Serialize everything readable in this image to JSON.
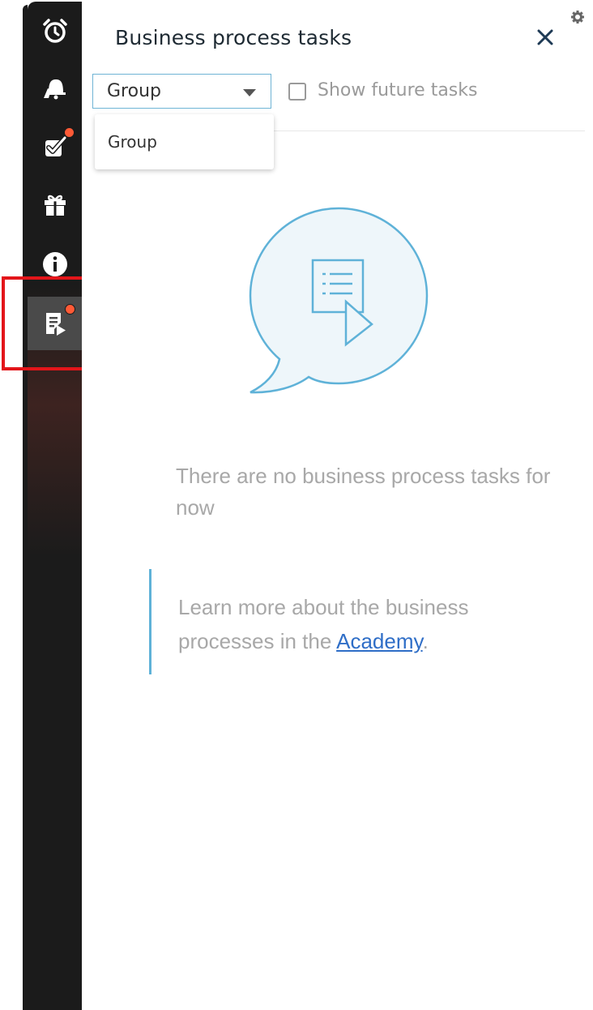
{
  "panel": {
    "title": "Business process tasks",
    "filter": {
      "selected": "Group",
      "options": [
        "Group"
      ]
    },
    "show_future_label": "Show future tasks",
    "show_future_checked": false,
    "empty_message": "There are no business process tasks for now",
    "info": {
      "before": "Learn more about the business processes in the ",
      "link": "Academy",
      "after": "."
    }
  },
  "sidebar": {
    "items": [
      {
        "icon": "alarm-clock-icon",
        "badge": false
      },
      {
        "icon": "bell-hand-icon",
        "badge": false
      },
      {
        "icon": "task-check-icon",
        "badge": true
      },
      {
        "icon": "gift-icon",
        "badge": false
      },
      {
        "icon": "info-icon",
        "badge": false
      },
      {
        "icon": "business-process-icon",
        "badge": true,
        "active": true
      }
    ]
  },
  "colors": {
    "sidebar_bg": "#1b1b1b",
    "badge": "#ff5a36",
    "accent": "#5fb2d8",
    "link": "#2f6ec7",
    "highlight": "#e3151a"
  }
}
